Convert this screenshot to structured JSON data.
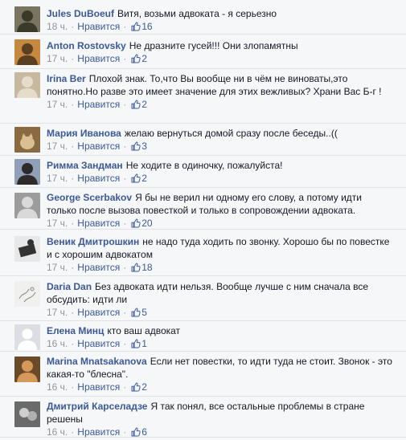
{
  "comments": [
    {
      "author": "Jules DuBoeuf",
      "text": "Витя, возьми адвоката - я серьезно",
      "time": "18 ч.",
      "like_label": "Нравится",
      "likes": "16",
      "avatar": {
        "icon": "man-portrait",
        "bg": "#7a7560",
        "fg": "#3b3a2a"
      }
    },
    {
      "author": "Anton Rostovsky",
      "text": "Не дразните гусей!!! Они злопамятны",
      "time": "17 ч.",
      "like_label": "Нравится",
      "likes": "2",
      "avatar": {
        "icon": "man-with-glasses",
        "bg": "#c4883f",
        "fg": "#5a3f22"
      }
    },
    {
      "author": "Irina Ber",
      "text": "Плохой знак. То,что Вы вообще ни в чём не виноваты,это понятно.Но разве это имеет значение для этих вежливых? Храни Вас Б-г !",
      "time": "17 ч.",
      "like_label": "Нравится",
      "likes": "2",
      "avatar": {
        "icon": "woman-portrait",
        "bg": "#c7b8a0",
        "fg": "#e6dccb"
      }
    },
    {
      "author": "Мария Иванова",
      "text": "желаю вернуться домой сразу после беседы..((",
      "time": "17 ч.",
      "like_label": "Нравится",
      "likes": "3",
      "avatar": {
        "icon": "cat-photo",
        "bg": "#8a6a40",
        "fg": "#d8c090"
      }
    },
    {
      "author": "Римма Зандман",
      "text": "Не ходите в одиночку, пожалуйста!",
      "time": "17 ч.",
      "like_label": "Нравится",
      "likes": "2",
      "avatar": {
        "icon": "woman-portrait",
        "bg": "#8fa0b8",
        "fg": "#2d2a2a"
      }
    },
    {
      "author": "George Scerbakov",
      "text": "Я бы не верил ни одному его слову, а потому идти только после вызова повесткой и только в сопровождении адвоката.",
      "time": "17 ч.",
      "like_label": "Нравится",
      "likes": "20",
      "avatar": {
        "icon": "grey-portrait",
        "bg": "#9c9c9c",
        "fg": "#d9d9d9"
      }
    },
    {
      "author": "Веник Дмитрошкин",
      "text": "не надо туда ходить по звонку. Хорошо бы по повестке и с хорошим адвокатом",
      "time": "17 ч.",
      "like_label": "Нравится",
      "likes": "18",
      "avatar": {
        "icon": "sign-photo",
        "bg": "#e8e8e8",
        "fg": "#333333"
      }
    },
    {
      "author": "Daria Dan",
      "text": "Без адвоката идти нельзя. Вообще лучше с ним сначала все обсудить: идти ли",
      "time": "17 ч.",
      "like_label": "Нравится",
      "likes": "5",
      "avatar": {
        "icon": "sketch",
        "bg": "#f0f0ee",
        "fg": "#888888"
      }
    },
    {
      "author": "Елена Минц",
      "text": "кто ваш адвокат",
      "time": "16 ч.",
      "like_label": "Нравится",
      "likes": "1",
      "avatar": {
        "icon": "default-silhouette",
        "bg": "#dcdee3",
        "fg": "#ffffff"
      }
    },
    {
      "author": "Marina Mnatsakanova",
      "text": "Если нет повестки, то идти туда не стоит. Звонок - это какая-то \"блесна\".",
      "time": "16 ч.",
      "like_label": "Нравится",
      "likes": "2",
      "avatar": {
        "icon": "man-portrait",
        "bg": "#6b4a28",
        "fg": "#d59a5a"
      }
    },
    {
      "author": "Дмитрий Карселадзе",
      "text": "Я так понял, все остальные проблемы в стране решены",
      "time": "16 ч.",
      "like_label": "Нравится",
      "likes": "6",
      "avatar": {
        "icon": "bw-photo",
        "bg": "#6a6a6a",
        "fg": "#cfcfcf"
      }
    }
  ],
  "colors": {
    "author": "#3b5998",
    "meta": "#90949c",
    "background": "#f6f7f9",
    "divider": "#e1e2e3"
  }
}
